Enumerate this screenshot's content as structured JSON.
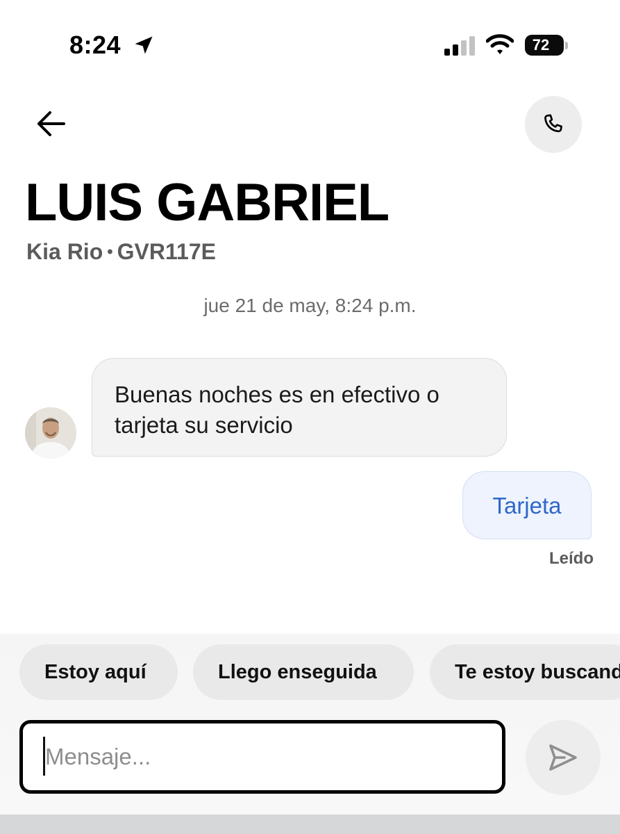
{
  "status_bar": {
    "time": "8:24",
    "battery": "72"
  },
  "header": {
    "driver_name": "LUIS GABRIEL",
    "vehicle_model": "Kia Rio",
    "separator": "•",
    "plate": "GVR117E"
  },
  "conversation": {
    "date": "jue 21 de may, 8:24 p.m.",
    "messages": [
      {
        "from": "driver",
        "text": "Buenas noches es en efectivo o tarjeta su servicio"
      },
      {
        "from": "me",
        "text": "Tarjeta",
        "status": "Leído"
      }
    ]
  },
  "quick_replies": [
    "Estoy aquí",
    "Llego enseguida",
    "Te estoy buscando"
  ],
  "composer": {
    "placeholder": "Mensaje..."
  },
  "colors": {
    "outgoing_text": "#2f67c9",
    "outgoing_bg": "#eef3fd",
    "incoming_bg": "#f3f3f3"
  }
}
